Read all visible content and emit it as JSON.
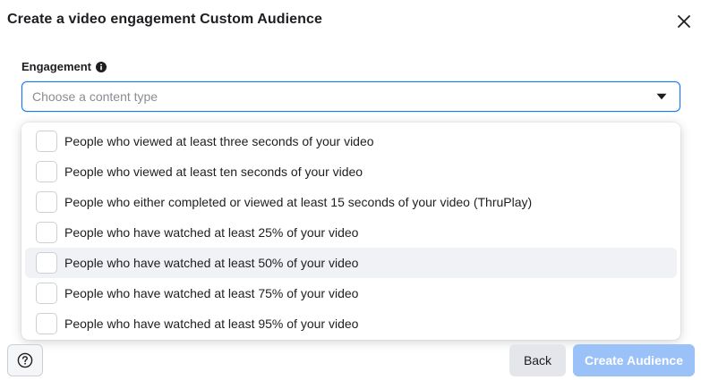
{
  "dialog": {
    "title": "Create a video engagement Custom Audience",
    "close_icon": "close-icon"
  },
  "engagement": {
    "label": "Engagement",
    "info_icon": "info-icon",
    "placeholder": "Choose a content type",
    "caret_icon": "caret-down-icon"
  },
  "options": [
    {
      "label": "People who viewed at least three seconds of your video",
      "checked": false
    },
    {
      "label": "People who viewed at least ten seconds of your video",
      "checked": false
    },
    {
      "label": "People who either completed or viewed at least 15 seconds of your video (ThruPlay)",
      "checked": false
    },
    {
      "label": "People who have watched at least 25% of your video",
      "checked": false
    },
    {
      "label": "People who have watched at least 50% of your video",
      "checked": false
    },
    {
      "label": "People who have watched at least 75% of your video",
      "checked": false
    },
    {
      "label": "People who have watched at least 95% of your video",
      "checked": false
    }
  ],
  "hovered_option_index": 4,
  "footer": {
    "help_icon": "question-circle-icon",
    "back_label": "Back",
    "create_label": "Create Audience"
  },
  "colors": {
    "accent": "#1877f2",
    "disabled_primary": "#9bc2f8",
    "hover_row": "#f0f2f5"
  }
}
